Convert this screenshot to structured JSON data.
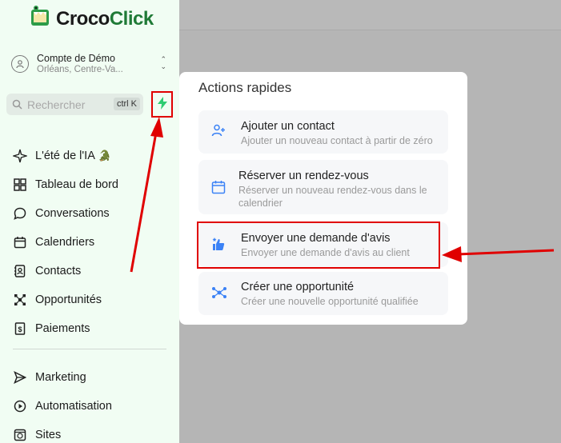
{
  "brand": {
    "part1": "Croco",
    "part2": "Click"
  },
  "account": {
    "name": "Compte de Démo",
    "location": "Orléans, Centre-Va..."
  },
  "search": {
    "placeholder": "Rechercher",
    "shortcut": "ctrl K"
  },
  "nav": {
    "items": [
      {
        "label": "L'été de l'IA",
        "icon": "sparkles-icon"
      },
      {
        "label": "Tableau de bord",
        "icon": "dashboard-grid-icon"
      },
      {
        "label": "Conversations",
        "icon": "chat-bubble-icon"
      },
      {
        "label": "Calendriers",
        "icon": "calendar-icon"
      },
      {
        "label": "Contacts",
        "icon": "contact-book-icon"
      },
      {
        "label": "Opportunités",
        "icon": "opportunities-icon"
      },
      {
        "label": "Paiements",
        "icon": "payments-icon"
      }
    ],
    "items2": [
      {
        "label": "Marketing",
        "icon": "send-icon"
      },
      {
        "label": "Automatisation",
        "icon": "automation-icon"
      },
      {
        "label": "Sites",
        "icon": "globe-icon"
      }
    ]
  },
  "quick_actions": {
    "title": "Actions rapides",
    "cards": [
      {
        "title": "Ajouter un contact",
        "desc": "Ajouter un nouveau contact à partir de zéro",
        "icon": "add-user-icon"
      },
      {
        "title": "Réserver un rendez-vous",
        "desc": "Réserver un nouveau rendez-vous dans le calendrier",
        "icon": "calendar-icon"
      },
      {
        "title": "Envoyer une demande d'avis",
        "desc": "Envoyer une demande d'avis au client",
        "icon": "review-thumbs-icon"
      },
      {
        "title": "Créer une opportunité",
        "desc": "Créer une nouvelle opportunité qualifiée",
        "icon": "network-icon"
      }
    ]
  },
  "colors": {
    "accent": "#2ecc71",
    "highlight": "#e00000",
    "sidebar_bg": "#f1fdf3"
  }
}
